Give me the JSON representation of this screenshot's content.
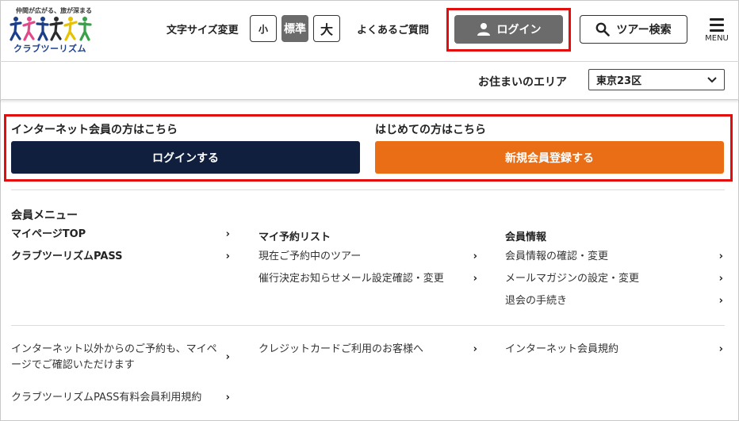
{
  "header": {
    "logo": {
      "tagline": "仲間が広がる、旅が深まる",
      "name": "クラブツーリズム",
      "colors": [
        "#1d3f8a",
        "#e04a8a",
        "#1d3f8a",
        "#2c2c2c",
        "#e6c200",
        "#3aa14a"
      ]
    },
    "font_size": {
      "label": "文字サイズ変更",
      "small": "小",
      "standard": "標準",
      "large": "大",
      "selected": "標準"
    },
    "faq": "よくあるご質問",
    "login": {
      "label": "ログイン",
      "icon": "user-icon"
    },
    "tour_search": {
      "label": "ツアー検索",
      "icon": "search-icon"
    },
    "menu": {
      "label": "MENU",
      "icon": "hamburger-icon"
    }
  },
  "area": {
    "label": "お住まいのエリア",
    "selected": "東京23区"
  },
  "login_section": {
    "member_label": "インターネット会員の方はこちら",
    "member_button": "ログインする",
    "new_label": "はじめての方はこちら",
    "new_button": "新規会員登録する"
  },
  "member_menu": {
    "title": "会員メニュー",
    "col1": {
      "items": [
        "マイページTOP",
        "クラブツーリズムPASS"
      ]
    },
    "col2": {
      "heading": "マイ予約リスト",
      "items": [
        "現在ご予約中のツアー",
        "催行決定お知らせメール設定確認・変更"
      ]
    },
    "col3": {
      "heading": "会員情報",
      "items": [
        "会員情報の確認・変更",
        "メールマガジンの設定・変更",
        "退会の手続き"
      ]
    }
  },
  "footer_links": {
    "items": [
      "インターネット以外からのご予約も、マイページでご確認いただけます",
      "クレジットカードご利用のお客様へ",
      "インターネット会員規約",
      "クラブツーリズムPASS有料会員利用規約"
    ]
  },
  "colors": {
    "highlight": "#e30d0d",
    "navy": "#0f1f3d",
    "orange": "#ea6e16",
    "gray_button": "#6b6b6b"
  }
}
